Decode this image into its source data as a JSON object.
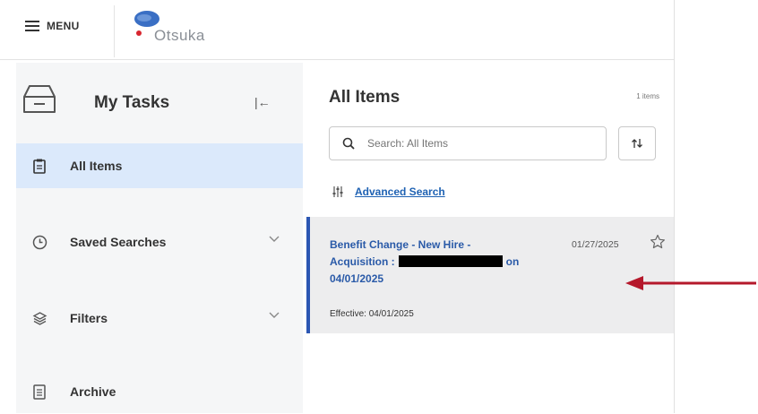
{
  "topbar": {
    "menu_label": "MENU",
    "logo_text": "Otsuka",
    "logo_colors": {
      "blue": "#3a6fc4",
      "red": "#d8262f"
    }
  },
  "sidebar": {
    "title": "My Tasks",
    "collapse_icon": "collapse-left-icon",
    "items": [
      {
        "label": "All Items",
        "icon": "clipboard-icon",
        "active": true
      },
      {
        "label": "Saved Searches",
        "icon": "clock-icon",
        "expandable": true
      },
      {
        "label": "Filters",
        "icon": "layers-icon",
        "expandable": true
      },
      {
        "label": "Archive",
        "icon": "archive-icon"
      }
    ]
  },
  "main": {
    "title": "All Items",
    "count": "1 items",
    "search": {
      "placeholder": "Search: All Items"
    },
    "advanced_search": "Advanced Search",
    "tasks": [
      {
        "subject_part1": "Benefit Change - New Hire - Acquisition :",
        "subject_on": "on",
        "subject_date": "04/01/2025",
        "date": "01/27/2025",
        "effective": "Effective: 04/01/2025"
      }
    ]
  },
  "colors": {
    "accent": "#2c57b3",
    "active_bg": "#dbe9fb",
    "arrow": "#b5182b"
  }
}
